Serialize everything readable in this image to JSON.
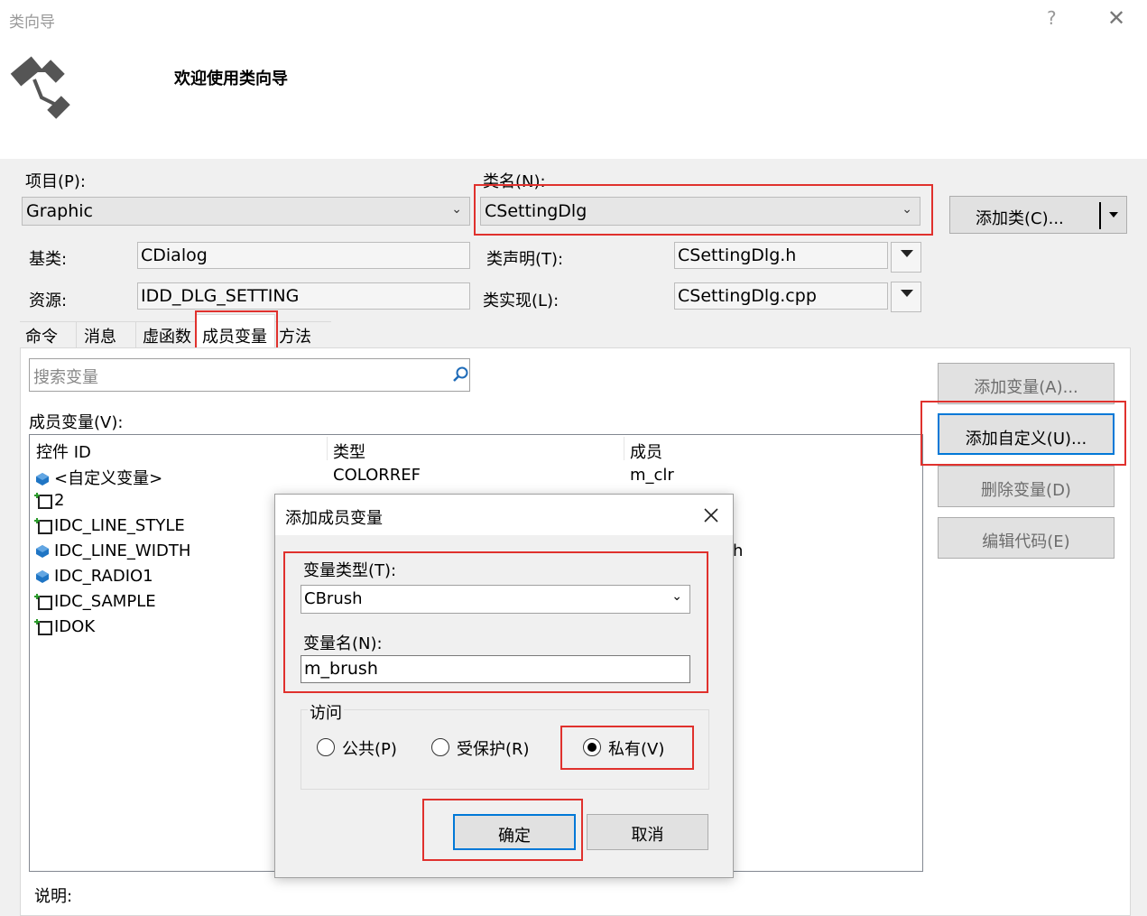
{
  "window": {
    "title": "类向导",
    "help": "?",
    "close": "✕"
  },
  "header": {
    "welcome": "欢迎使用类向导"
  },
  "project": {
    "label": "项目(P):",
    "value": "Graphic"
  },
  "classname": {
    "label": "类名(N):",
    "value": "CSettingDlg"
  },
  "add_class_button": "添加类(C)...",
  "base_class": {
    "label": "基类:",
    "value": "CDialog"
  },
  "resource": {
    "label": "资源:",
    "value": "IDD_DLG_SETTING"
  },
  "class_decl": {
    "label": "类声明(T):",
    "value": "CSettingDlg.h"
  },
  "class_impl": {
    "label": "类实现(L):",
    "value": "CSettingDlg.cpp"
  },
  "tabs": [
    "命令",
    "消息",
    "虚函数",
    "成员变量",
    "方法"
  ],
  "search": {
    "placeholder": "搜索变量"
  },
  "member_vars_label": "成员变量(V):",
  "columns": [
    "控件 ID",
    "类型",
    "成员"
  ],
  "rows": [
    {
      "id": "<自定义变量>",
      "type": "COLORREF",
      "member": "m_clr"
    },
    {
      "id": "2",
      "type": "",
      "member": ""
    },
    {
      "id": "IDC_LINE_STYLE",
      "type": "",
      "member": ""
    },
    {
      "id": "IDC_LINE_WIDTH",
      "type": "",
      "member": "h"
    },
    {
      "id": "IDC_RADIO1",
      "type": "",
      "member": ""
    },
    {
      "id": "IDC_SAMPLE",
      "type": "",
      "member": ""
    },
    {
      "id": "IDOK",
      "type": "",
      "member": ""
    }
  ],
  "side_buttons": {
    "add_var": "添加变量(A)...",
    "add_custom": "添加自定义(U)...",
    "delete_var": "删除变量(D)",
    "edit_code": "编辑代码(E)"
  },
  "description_label": "说明:",
  "dialog": {
    "title": "添加成员变量",
    "var_type_label": "变量类型(T):",
    "var_type_value": "CBrush",
    "var_name_label": "变量名(N):",
    "var_name_value": "m_brush",
    "access_label": "访问",
    "access_options": [
      "公共(P)",
      "受保护(R)",
      "私有(V)"
    ],
    "access_selected": "私有(V)",
    "ok": "确定",
    "cancel": "取消"
  },
  "colors": {
    "highlight": "#e0312d",
    "focus_border": "#0078d7"
  }
}
